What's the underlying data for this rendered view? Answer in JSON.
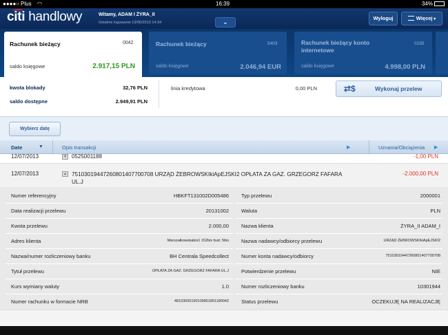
{
  "status_bar": {
    "carrier": "Plus",
    "time": "16:39",
    "battery": "34%"
  },
  "header": {
    "brand_citi": "citi",
    "brand_rest": "handlowy",
    "welcome": "Witamy, ADAM  I ŻYRA_II",
    "last_login": "Ostatnie logowanie 13/06/2013 14:34",
    "expand_icon": "chevron-down-icon",
    "logout_label": "Wyloguj",
    "more_label": "Więcej",
    "more_icon": "menu-icon"
  },
  "accounts": [
    {
      "name": "Rachunek bieżący",
      "number": "0042",
      "saldo_label": "saldo księgowe",
      "balance": "2.917,15 PLN"
    },
    {
      "name": "Rachunek bieżący",
      "number": "5403",
      "saldo_label": "saldo księgowe",
      "balance": "2.046,94 EUR"
    },
    {
      "name": "Rachunek bieżący konto internetowe",
      "number": "0155",
      "saldo_label": "saldo księgowe",
      "balance": "4.998,00 PLN"
    }
  ],
  "balance_panel": {
    "blocked_label": "kwota blokady",
    "blocked_value": "32,76 PLN",
    "available_label": "saldo dostępne",
    "available_value": "2.949,91 PLN",
    "credit_label": "linia kredytowa",
    "credit_value": "0,00 PLN",
    "transfer_label": "Wykonaj przelew",
    "transfer_icon": "transfer-arrows-dollar-icon"
  },
  "filter": {
    "date_button": "Wybierz datę"
  },
  "columns": {
    "date": "Date",
    "description": "Opis transakcji",
    "amount": "Uznania/Obciążenia"
  },
  "transactions": [
    {
      "date": "12/07/2013",
      "description": "0525001188",
      "amount": "-1,00 PLN"
    },
    {
      "date": "12/07/2013",
      "description": "75103019447260801407700708 URZĄD ŻEBROWSKIkiApEJSKI2 OPŁATA ZA GAZ. GRZEGORZ FAFARA UL.J",
      "amount": "-2.000,00 PLN"
    }
  ],
  "details_left": [
    {
      "label": "Numer referencyjny",
      "value": "HBKFT131002D005486"
    },
    {
      "label": "Data realizacji przelewu",
      "value": "20131002"
    },
    {
      "label": "Kwota przelewu",
      "value": "2.000,00"
    },
    {
      "label": "Adres klienta",
      "value": "Marszałkowskabis1 152bis bud. 5bis"
    },
    {
      "label": "Nazwa/numer rozliczeniowy banku",
      "value": "BH Centrala Speedcollect"
    },
    {
      "label": "Tytuł przelewu",
      "value": "OPŁATA ZA GAZ. GRZEGORZ FAFARA UL.J"
    },
    {
      "label": "Kurs wymiany waluty",
      "value": "1.0"
    },
    {
      "label": "Numer rachunku w formacie NRB",
      "value": "48103000190109851801180042"
    }
  ],
  "details_right": [
    {
      "label": "Typ przelewu",
      "value": "2000001"
    },
    {
      "label": "Waluta",
      "value": "PLN"
    },
    {
      "label": "Nazwa klienta",
      "value": "ŻYRA_II ADAM_I"
    },
    {
      "label": "Nazwa nadawcy/odbiorcy przelewu",
      "value": "URZĄD ŻEBROWSKIkiApEJSKI2"
    },
    {
      "label": "Numer konta nadawcy/odbiorcy",
      "value": "75103019447260801407700708"
    },
    {
      "label": "Potwierdzenie przelewu",
      "value": "NIE"
    },
    {
      "label": "Numer rozliczeniowy banku",
      "value": "10301944"
    },
    {
      "label": "Status przelewu",
      "value": "OCZEKUJĘ NA REALIZACJĘ"
    }
  ],
  "colors": {
    "header_bg": "#0a2857",
    "positive_balance": "#2e9a1e",
    "negative_amount": "#e0321e",
    "link_blue": "#2d5fa0"
  }
}
